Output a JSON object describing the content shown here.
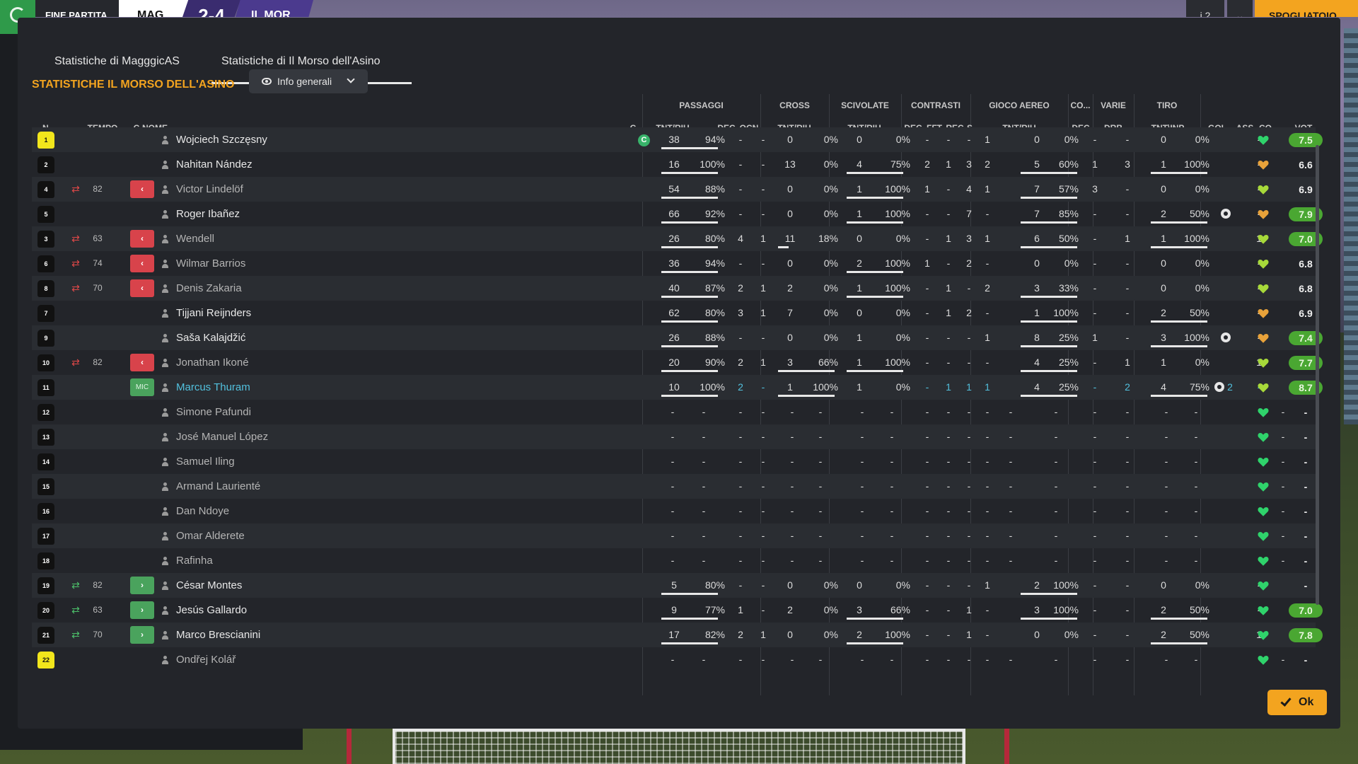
{
  "topbar": {
    "status": "FINE PARTITA",
    "home_team": "MAG",
    "score": "2-4",
    "away_team": "IL MOR",
    "info": "i 2",
    "go_button": "SPOGLIATOIO"
  },
  "tabs": [
    "Statistiche di MagggicAS",
    "Statistiche di Il Morso dell'Asino"
  ],
  "active_tab": 1,
  "section_title": "STATISTICHE IL MORSO DELL'ASINO",
  "view_dropdown": "Info generali",
  "columns": {
    "group_headers": [
      "PASSAGGI",
      "CROSS",
      "SCIVOLATE",
      "CONTRASTI",
      "GIOCO AEREO",
      "CO...",
      "VARIE",
      "TIRO"
    ],
    "sub_headers": [
      "N.",
      "TEMPO",
      "C",
      "NOME",
      "C",
      "TNT/RIU",
      "DEC",
      "OCN",
      "TNT/RIU",
      "TNT/RIU",
      "DEC",
      "FFT",
      "REC",
      "S...",
      "TNT/RIU",
      "DEC",
      "DRB",
      "TNT\\INP",
      "GOL",
      "ASS",
      "CO...",
      "VOT"
    ]
  },
  "players": [
    {
      "num": "1",
      "gk": true,
      "sub": "",
      "min": "",
      "badge": "",
      "name": "Wojciech Szczęsny",
      "style": "starter",
      "captain": "C",
      "pass": [
        "38",
        "94%",
        80
      ],
      "dec": "-",
      "ocn": "-",
      "cross": [
        "0",
        "0%",
        0
      ],
      "sciv": [
        "0",
        "0%",
        0
      ],
      "c_dec": "-",
      "fft": "-",
      "rec": "-",
      "s": "1",
      "aereo": [
        "0",
        "0%",
        0
      ],
      "co": "-",
      "drb": "-",
      "tiro": [
        "0",
        "0%",
        0
      ],
      "gol": "",
      "gears": 0,
      "ass": "-",
      "heart": "green",
      "vot": "7.5",
      "vot_hi": true
    },
    {
      "num": "2",
      "sub": "",
      "min": "",
      "badge": "",
      "name": "Nahitan Nández",
      "style": "starter",
      "pass": [
        "16",
        "100%",
        80
      ],
      "dec": "-",
      "ocn": "-",
      "cross": [
        "13",
        "0%",
        0
      ],
      "sciv": [
        "4",
        "75%",
        80
      ],
      "c_dec": "2",
      "fft": "1",
      "rec": "3",
      "s": "2",
      "aereo": [
        "5",
        "60%",
        80
      ],
      "co": "1",
      "drb": "3",
      "tiro": [
        "1",
        "100%",
        80
      ],
      "gol": "",
      "gears": 0,
      "ass": "-",
      "heart": "orange",
      "vot": "6.6",
      "vot_hi": false
    },
    {
      "num": "4",
      "sub": "out",
      "min": "82",
      "badge": "out",
      "name": "Victor Lindelöf",
      "style": "sub",
      "pass": [
        "54",
        "88%",
        80
      ],
      "dec": "-",
      "ocn": "-",
      "cross": [
        "0",
        "0%",
        0
      ],
      "sciv": [
        "1",
        "100%",
        80
      ],
      "c_dec": "1",
      "fft": "-",
      "rec": "4",
      "s": "1",
      "aereo": [
        "7",
        "57%",
        80
      ],
      "co": "3",
      "drb": "-",
      "tiro": [
        "0",
        "0%",
        0
      ],
      "gol": "",
      "gears": 0,
      "ass": "-",
      "heart": "lime",
      "vot": "6.9",
      "vot_hi": false
    },
    {
      "num": "5",
      "sub": "",
      "min": "",
      "badge": "",
      "name": "Roger Ibañez",
      "style": "starter",
      "pass": [
        "66",
        "92%",
        80
      ],
      "dec": "-",
      "ocn": "-",
      "cross": [
        "0",
        "0%",
        0
      ],
      "sciv": [
        "1",
        "100%",
        80
      ],
      "c_dec": "-",
      "fft": "-",
      "rec": "7",
      "s": "-",
      "aereo": [
        "7",
        "85%",
        80
      ],
      "co": "-",
      "drb": "-",
      "tiro": [
        "2",
        "50%",
        80
      ],
      "gol": "",
      "gears": 1,
      "ass": "-",
      "heart": "orange",
      "vot": "7.9",
      "vot_hi": true
    },
    {
      "num": "3",
      "sub": "out",
      "min": "63",
      "badge": "out",
      "name": "Wendell",
      "style": "sub",
      "pass": [
        "26",
        "80%",
        80
      ],
      "dec": "4",
      "ocn": "1",
      "cross": [
        "11",
        "18%",
        15
      ],
      "sciv": [
        "0",
        "0%",
        0
      ],
      "c_dec": "-",
      "fft": "1",
      "rec": "3",
      "s": "1",
      "aereo": [
        "6",
        "50%",
        80
      ],
      "co": "-",
      "drb": "1",
      "tiro": [
        "1",
        "100%",
        80
      ],
      "gol": "",
      "gears": 0,
      "ass": "1",
      "heart": "lime",
      "vot": "7.0",
      "vot_hi": true
    },
    {
      "num": "6",
      "sub": "out",
      "min": "74",
      "badge": "out",
      "name": "Wilmar Barrios",
      "style": "sub",
      "pass": [
        "36",
        "94%",
        80
      ],
      "dec": "-",
      "ocn": "-",
      "cross": [
        "0",
        "0%",
        0
      ],
      "sciv": [
        "2",
        "100%",
        80
      ],
      "c_dec": "1",
      "fft": "-",
      "rec": "2",
      "s": "-",
      "aereo": [
        "0",
        "0%",
        0
      ],
      "co": "-",
      "drb": "-",
      "tiro": [
        "0",
        "0%",
        0
      ],
      "gol": "",
      "gears": 0,
      "ass": "-",
      "heart": "lime",
      "vot": "6.8",
      "vot_hi": false
    },
    {
      "num": "8",
      "sub": "out",
      "min": "70",
      "badge": "out",
      "name": "Denis Zakaria",
      "style": "sub",
      "pass": [
        "40",
        "87%",
        80
      ],
      "dec": "2",
      "ocn": "1",
      "cross": [
        "2",
        "0%",
        0
      ],
      "sciv": [
        "1",
        "100%",
        80
      ],
      "c_dec": "-",
      "fft": "1",
      "rec": "-",
      "s": "2",
      "aereo": [
        "3",
        "33%",
        80
      ],
      "co": "-",
      "drb": "-",
      "tiro": [
        "0",
        "0%",
        0
      ],
      "gol": "",
      "gears": 0,
      "ass": "-",
      "heart": "lime",
      "vot": "6.8",
      "vot_hi": false
    },
    {
      "num": "7",
      "sub": "",
      "min": "",
      "badge": "",
      "name": "Tijjani Reijnders",
      "style": "starter",
      "pass": [
        "62",
        "80%",
        80
      ],
      "dec": "3",
      "ocn": "1",
      "cross": [
        "7",
        "0%",
        0
      ],
      "sciv": [
        "0",
        "0%",
        0
      ],
      "c_dec": "-",
      "fft": "1",
      "rec": "2",
      "s": "-",
      "aereo": [
        "1",
        "100%",
        80
      ],
      "co": "-",
      "drb": "-",
      "tiro": [
        "2",
        "50%",
        80
      ],
      "gol": "",
      "gears": 0,
      "ass": "-",
      "heart": "orange",
      "vot": "6.9",
      "vot_hi": false
    },
    {
      "num": "9",
      "sub": "",
      "min": "",
      "badge": "",
      "name": "Saša Kalajdžić",
      "style": "starter",
      "pass": [
        "26",
        "88%",
        80
      ],
      "dec": "-",
      "ocn": "-",
      "cross": [
        "0",
        "0%",
        0
      ],
      "sciv": [
        "1",
        "0%",
        0
      ],
      "c_dec": "-",
      "fft": "-",
      "rec": "-",
      "s": "1",
      "aereo": [
        "8",
        "25%",
        80
      ],
      "co": "1",
      "drb": "-",
      "tiro": [
        "3",
        "100%",
        80
      ],
      "gol": "",
      "gears": 1,
      "ass": "-",
      "heart": "orange",
      "vot": "7.4",
      "vot_hi": true
    },
    {
      "num": "10",
      "sub": "out",
      "min": "82",
      "badge": "out",
      "name": "Jonathan Ikoné",
      "style": "sub",
      "pass": [
        "20",
        "90%",
        80
      ],
      "dec": "2",
      "ocn": "1",
      "cross": [
        "3",
        "66%",
        80
      ],
      "sciv": [
        "1",
        "100%",
        80
      ],
      "c_dec": "-",
      "fft": "-",
      "rec": "-",
      "s": "-",
      "aereo": [
        "4",
        "25%",
        80
      ],
      "co": "-",
      "drb": "1",
      "tiro": [
        "1",
        "0%",
        0
      ],
      "gol": "",
      "gears": 0,
      "ass": "1",
      "heart": "lime",
      "vot": "7.7",
      "vot_hi": true
    },
    {
      "num": "11",
      "sub": "",
      "min": "",
      "badge": "pos",
      "badge_text": "MIC",
      "name": "Marcus Thuram",
      "style": "mom",
      "pass": [
        "10",
        "100%",
        80
      ],
      "dec": "2",
      "ocn": "-",
      "cross": [
        "1",
        "100%",
        80
      ],
      "sciv": [
        "1",
        "0%",
        0
      ],
      "c_dec": "-",
      "fft": "1",
      "rec": "1",
      "s": "1",
      "aereo": [
        "4",
        "25%",
        80
      ],
      "co": "-",
      "drb": "2",
      "tiro": [
        "4",
        "75%",
        80
      ],
      "gol": "2",
      "gears": 1,
      "ass": "-",
      "heart": "lime",
      "vot": "8.7",
      "vot_hi": true
    },
    {
      "num": "12",
      "name": "Simone Pafundi",
      "style": "sub",
      "empty": true,
      "heart": "green",
      "vot": "-"
    },
    {
      "num": "13",
      "name": "José Manuel López",
      "style": "sub",
      "empty": true,
      "heart": "green",
      "vot": "-"
    },
    {
      "num": "14",
      "name": "Samuel Iling",
      "style": "sub",
      "empty": true,
      "heart": "green",
      "vot": "-"
    },
    {
      "num": "15",
      "name": "Armand Laurienté",
      "style": "sub",
      "empty": true,
      "heart": "green",
      "vot": "-"
    },
    {
      "num": "16",
      "name": "Dan Ndoye",
      "style": "sub",
      "empty": true,
      "heart": "green",
      "vot": "-"
    },
    {
      "num": "17",
      "name": "Omar Alderete",
      "style": "sub",
      "empty": true,
      "heart": "green",
      "vot": "-"
    },
    {
      "num": "18",
      "name": "Rafinha",
      "style": "sub",
      "empty": true,
      "heart": "green",
      "vot": "-"
    },
    {
      "num": "19",
      "sub": "in",
      "min": "82",
      "badge": "in",
      "name": "César Montes",
      "style": "starter",
      "pass": [
        "5",
        "80%",
        80
      ],
      "dec": "-",
      "ocn": "-",
      "cross": [
        "0",
        "0%",
        0
      ],
      "sciv": [
        "0",
        "0%",
        0
      ],
      "c_dec": "-",
      "fft": "-",
      "rec": "-",
      "s": "1",
      "aereo": [
        "2",
        "100%",
        80
      ],
      "co": "-",
      "drb": "-",
      "tiro": [
        "0",
        "0%",
        0
      ],
      "gol": "",
      "gears": 0,
      "ass": "-",
      "heart": "green",
      "vot": "-",
      "vot_hi": false
    },
    {
      "num": "20",
      "sub": "in",
      "min": "63",
      "badge": "in",
      "name": "Jesús Gallardo",
      "style": "starter",
      "pass": [
        "9",
        "77%",
        80
      ],
      "dec": "1",
      "ocn": "-",
      "cross": [
        "2",
        "0%",
        0
      ],
      "sciv": [
        "3",
        "66%",
        80
      ],
      "c_dec": "-",
      "fft": "-",
      "rec": "1",
      "s": "-",
      "aereo": [
        "3",
        "100%",
        80
      ],
      "co": "-",
      "drb": "-",
      "tiro": [
        "2",
        "50%",
        80
      ],
      "gol": "",
      "gears": 0,
      "ass": "-",
      "heart": "green",
      "vot": "7.0",
      "vot_hi": true
    },
    {
      "num": "21",
      "sub": "in",
      "min": "70",
      "badge": "in",
      "name": "Marco Brescianini",
      "style": "starter",
      "pass": [
        "17",
        "82%",
        80
      ],
      "dec": "2",
      "ocn": "1",
      "cross": [
        "0",
        "0%",
        0
      ],
      "sciv": [
        "2",
        "100%",
        80
      ],
      "c_dec": "-",
      "fft": "-",
      "rec": "1",
      "s": "-",
      "aereo": [
        "0",
        "0%",
        0
      ],
      "co": "-",
      "drb": "-",
      "tiro": [
        "2",
        "50%",
        80
      ],
      "gol": "",
      "gears": 0,
      "ass": "1",
      "heart": "green",
      "vot": "7.8",
      "vot_hi": true
    },
    {
      "num": "22",
      "gk": true,
      "name": "Ondřej Kolář",
      "style": "sub",
      "empty": true,
      "heart": "green",
      "vot": "-"
    }
  ],
  "ok_button": "Ok",
  "colors": {
    "accent": "#f3a41f",
    "mom": "#52c1de",
    "rating_green": "#4aa732",
    "out_red": "#d8434b",
    "in_green": "#4aa35d"
  }
}
